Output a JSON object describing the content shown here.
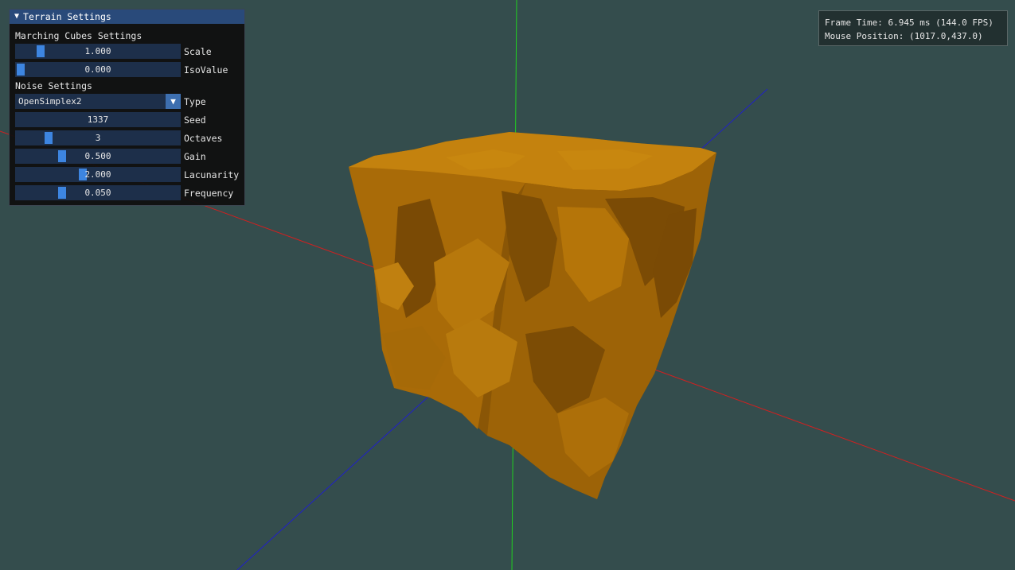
{
  "window": {
    "title": "Terrain Settings"
  },
  "marching_cubes": {
    "header": "Marching Cubes Settings",
    "scale": {
      "value": "1.000",
      "label": "Scale",
      "fraction": 0.13
    },
    "isovalue": {
      "value": "0.000",
      "label": "IsoValue",
      "fraction": 0.0
    }
  },
  "noise": {
    "header": "Noise Settings",
    "type": {
      "value": "OpenSimplex2",
      "label": "Type"
    },
    "seed": {
      "value": "1337",
      "label": "Seed"
    },
    "octaves": {
      "value": "3",
      "label": "Octaves",
      "fraction": 0.18
    },
    "gain": {
      "value": "0.500",
      "label": "Gain",
      "fraction": 0.27
    },
    "lacunarity": {
      "value": "2.000",
      "label": "Lacunarity",
      "fraction": 0.4
    },
    "frequency": {
      "value": "0.050",
      "label": "Frequency",
      "fraction": 0.27
    }
  },
  "overlay": {
    "frame_time": "Frame Time: 6.945 ms (144.0 FPS)",
    "mouse_position": "Mouse Position: (1017.0,437.0)"
  },
  "colors": {
    "background": "#344d4d",
    "terrain": "#b8770c",
    "axis_x": "#d02020",
    "axis_y": "#20d020",
    "axis_z": "#2020c8",
    "accent": "#3d85e0"
  }
}
